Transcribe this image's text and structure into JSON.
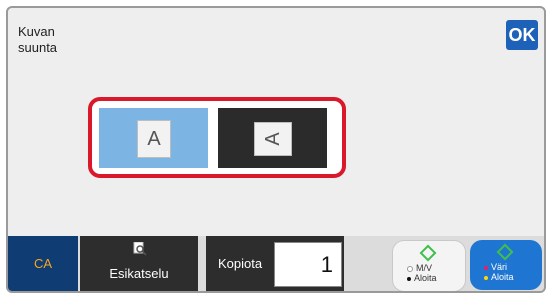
{
  "dialog": {
    "title_line1": "Kuvan",
    "title_line2": "suunta",
    "ok_label": "OK"
  },
  "orientation": {
    "options": [
      {
        "glyph": "A",
        "state": "selected"
      },
      {
        "glyph": "A",
        "state": "unselected"
      }
    ]
  },
  "bottom_bar": {
    "ca_label": "CA",
    "preview_label": "Esikatselu",
    "copies_label": "Kopiota",
    "copies_value": "1",
    "start_bw_line1": "M/V",
    "start_bw_line2": "Aloita",
    "start_color_line1": "Väri",
    "start_color_line2": "Aloita"
  },
  "colors": {
    "accent_blue": "#1d62b8",
    "selection_frame": "#d9182b",
    "selected_option": "#7cb5e3",
    "unselected_option": "#2b2b2b",
    "start_diamond": "#3fbf4b"
  }
}
